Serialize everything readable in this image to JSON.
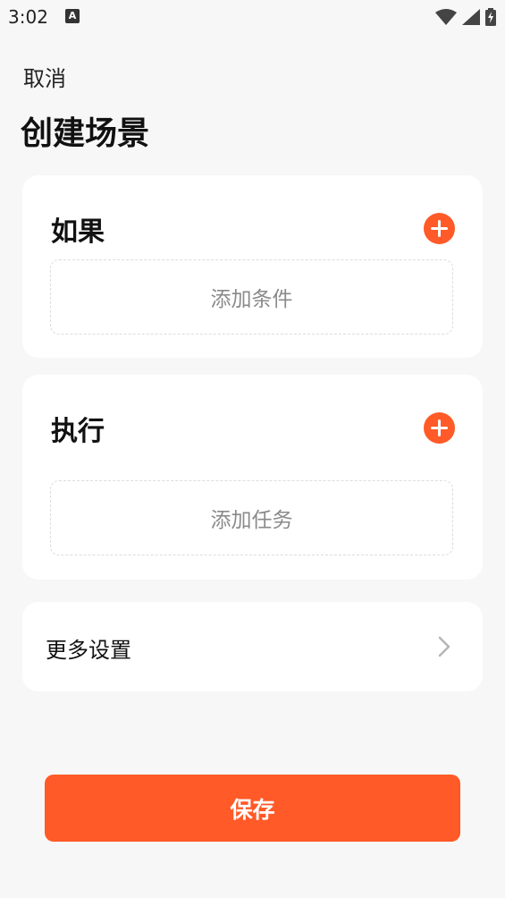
{
  "status_bar": {
    "time": "3:02",
    "notification_letter": "A"
  },
  "header": {
    "cancel_label": "取消",
    "title": "创建场景"
  },
  "condition_card": {
    "heading": "如果",
    "add_placeholder": "添加条件"
  },
  "action_card": {
    "heading": "执行",
    "add_placeholder": "添加任务"
  },
  "more_settings": {
    "label": "更多设置"
  },
  "footer": {
    "save_label": "保存"
  },
  "colors": {
    "accent": "#ff5a28",
    "background": "#f7f7f7",
    "card": "#ffffff"
  }
}
